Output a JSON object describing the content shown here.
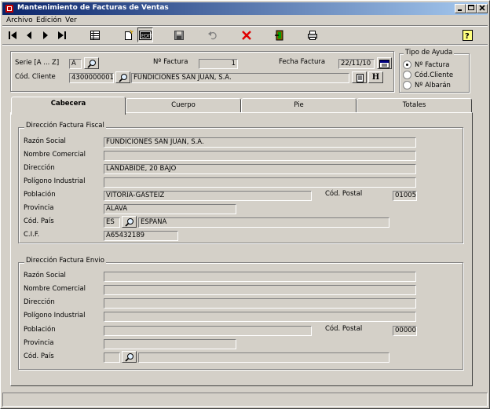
{
  "window": {
    "title": "Mantenimiento de Facturas de Ventas"
  },
  "menu": {
    "archivo": "Archivo",
    "edicion": "Edición",
    "ver": "Ver"
  },
  "header": {
    "serie_label": "Serie [A ... Z]",
    "serie_value": "A",
    "factura_label": "Nº Factura",
    "factura_value": "1",
    "fecha_label": "Fecha Factura",
    "fecha_value": "22/11/10",
    "cliente_label": "Cód. Cliente",
    "cliente_code": "4300000001",
    "cliente_name": "FUNDICIONES SAN JUAN, S.A.",
    "h_button": "H"
  },
  "ayuda": {
    "title": "Tipo de Ayuda",
    "options": [
      "Nº Factura",
      "Cód.Cliente",
      "Nº Albarán"
    ],
    "selected": "Nº Factura"
  },
  "tabs": [
    "Cabecera",
    "Cuerpo",
    "Pie",
    "Totales"
  ],
  "fiscal": {
    "title": "Dirección Factura Fiscal",
    "razon_label": "Razón Social",
    "razon_value": "FUNDICIONES SAN JUAN, S.A.",
    "nombre_label": "Nombre Comercial",
    "nombre_value": "",
    "direccion_label": "Dirección",
    "direccion_value": "LANDABIDE, 20 BAJO",
    "poligono_label": "Polígono Industrial",
    "poligono_value": "",
    "poblacion_label": "Población",
    "poblacion_value": "VITORIA-GASTEIZ",
    "cp_label": "Cód. Postal",
    "cp_value": "01005",
    "provincia_label": "Provincia",
    "provincia_value": "ALAVA",
    "pais_label": "Cód. País",
    "pais_code": "ES",
    "pais_name": "ESPAÑA",
    "cif_label": "C.I.F.",
    "cif_value": "A65432189"
  },
  "envio": {
    "title": "Dirección Factura Envio",
    "razon_label": "Razón Social",
    "razon_value": "",
    "nombre_label": "Nombre Comercial",
    "nombre_value": "",
    "direccion_label": "Dirección",
    "direccion_value": "",
    "poligono_label": "Polígono Industrial",
    "poligono_value": "",
    "poblacion_label": "Población",
    "poblacion_value": "",
    "cp_label": "Cód. Postal",
    "cp_value": "00000",
    "provincia_label": "Provincia",
    "provincia_value": "",
    "pais_label": "Cód. País",
    "pais_code": "",
    "pais_name": ""
  }
}
